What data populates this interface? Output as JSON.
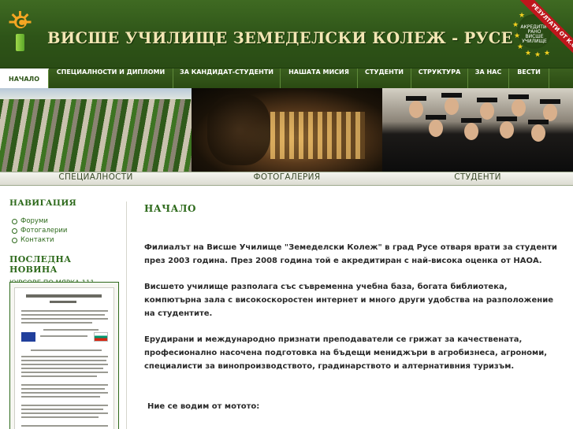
{
  "header": {
    "site_title": "ВИСШЕ УЧИЛИЩЕ ЗЕМЕДЕЛСКИ КОЛЕЖ - РУСЕ",
    "badge_text_1": "АКРЕДИТИ-",
    "badge_text_2": "РАНО",
    "badge_text_3": "ВИСШЕ",
    "badge_text_4": "УЧИЛИЩЕ",
    "ribbon_text": "РЕЗУЛТАТИ ОТ К.С.К."
  },
  "nav": {
    "items": [
      {
        "label": "НАЧАЛО",
        "active": true
      },
      {
        "label": "СПЕЦИАЛНОСТИ И ДИПЛОМИ",
        "active": false
      },
      {
        "label": "ЗА КАНДИДАТ-СТУДЕНТИ",
        "active": false
      },
      {
        "label": "НАШАТА МИСИЯ",
        "active": false
      },
      {
        "label": "СТУДЕНТИ",
        "active": false
      },
      {
        "label": "СТРУКТУРА",
        "active": false
      },
      {
        "label": "ЗА НАС",
        "active": false
      },
      {
        "label": "ВЕСТИ",
        "active": false
      }
    ]
  },
  "strip": {
    "labels": [
      "СПЕЦИАЛНОСТИ",
      "ФОТОГАЛЕРИЯ",
      "СТУДЕНТИ"
    ]
  },
  "sidebar": {
    "navigation_heading": "НАВИГАЦИЯ",
    "links": [
      "Форуми",
      "Фотогалерии",
      "Контакти"
    ],
    "news_heading": "ПОСЛЕДНА НОВИНА",
    "news_link": "КУРСОВЕ ПО МЯРКА 111"
  },
  "main": {
    "title": "НАЧАЛО",
    "paragraphs": [
      "Филиалът на Висше Училище \"Земеделски Колеж\" в град Русе отваря врати за студенти през 2003 година. През 2008 година той е акредитиран с най-висока оценка от НАОА.",
      "Висшето училище разполага със съвременна учебна база, богата библиотека, компютърна зала с високоскоростен интернет и много други удобства на разположение на студентите.",
      "Ерудирани и международно признати преподаватели се грижат за качествената, професионално насочена подготовка на бъдещи мениджъри в агробизнеса, агрономи, специалисти за винопроизводството, градинарството и алтернативния туризъм.",
      "Ние се водим от мотото:"
    ]
  },
  "colors": {
    "header_green": "#2e5418",
    "title_cream": "#f3e6b4",
    "accent_green": "#2e6a1c",
    "ribbon_red": "#c0161c",
    "star_yellow": "#f5d020"
  },
  "icons": {
    "logo": "sun-sprout-logo",
    "badge": "accreditation-stars-badge"
  }
}
